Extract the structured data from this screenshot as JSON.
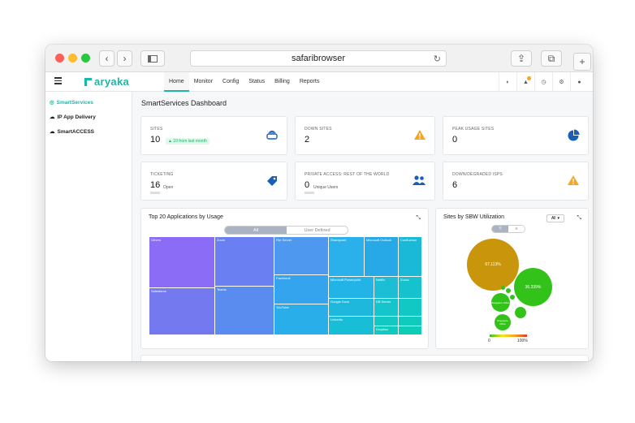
{
  "browser": {
    "url": "safaribrowser"
  },
  "nav": {
    "logo": "aryaka",
    "tabs": [
      "Home",
      "Monitor",
      "Config",
      "Status",
      "Billing",
      "Reports"
    ],
    "active_tab": "Home",
    "notification_count": "4"
  },
  "sidebar": {
    "items": [
      "SmartServices",
      "IP App Delivery",
      "SmartACCESS"
    ]
  },
  "page": {
    "title": "SmartServices Dashboard"
  },
  "cards": {
    "sites": {
      "label": "SITES",
      "value": "10",
      "trend": "▲ 10 from last month"
    },
    "down_sites": {
      "label": "DOWN SITES",
      "value": "2"
    },
    "peak_usage": {
      "label": "PEAK USAGE SITES",
      "value": "0"
    },
    "ticketing": {
      "label": "TICKETING",
      "value": "16",
      "sub": "Open"
    },
    "private_access": {
      "label": "PRIVATE ACCESS: REST OF THE WORLD",
      "value": "0",
      "sub": "Unique Users"
    },
    "down_isps": {
      "label": "DOWN/DEGRADED ISPS",
      "value": "6"
    }
  },
  "top_apps": {
    "title": "Top 20 Applications by Usage",
    "toggle": [
      "All",
      "User Defined"
    ],
    "active_toggle": "All",
    "tiles": [
      "Others",
      "Zoom",
      "File Server",
      "Sharepoint",
      "Microsoft Outlook",
      "Confluence",
      "Salesforce",
      "Teams",
      "Facebook",
      "Microsoft Powerpoint",
      "Netflix",
      "Zuora",
      "Google Dock",
      "DB Server",
      "YouTube",
      "LinkedIn",
      "Dropbox"
    ]
  },
  "sbw": {
    "title": "Sites by SBW Utilization",
    "filter": "All",
    "bubble_large": "67.113%",
    "bubble_medium": "36.339%",
    "bubble_small_a": "Bangalore Office",
    "bubble_small_b": "Singapore Office",
    "legend_min": "0",
    "legend_max": "100%"
  },
  "colors": {
    "accent": "#1bb6a8",
    "warning": "#f5a623",
    "blue": "#1a5fb4",
    "gold": "#c9950a",
    "green": "#33c21a"
  }
}
